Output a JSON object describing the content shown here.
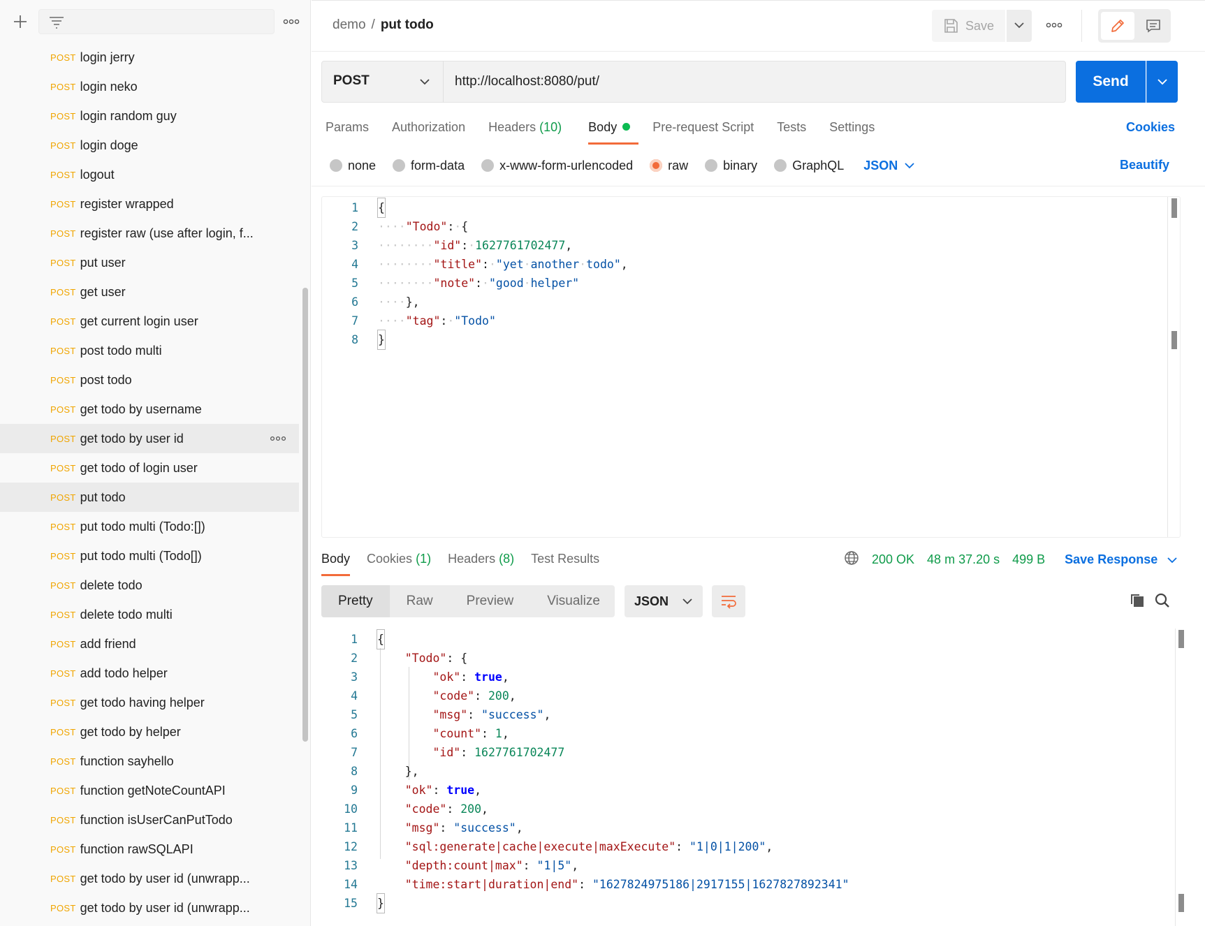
{
  "sidebar": {
    "items": [
      {
        "method": "POST",
        "label": "login jerry"
      },
      {
        "method": "POST",
        "label": "login neko"
      },
      {
        "method": "POST",
        "label": "login random guy"
      },
      {
        "method": "POST",
        "label": "login doge"
      },
      {
        "method": "POST",
        "label": "logout"
      },
      {
        "method": "POST",
        "label": "register wrapped"
      },
      {
        "method": "POST",
        "label": "register raw (use after login, f..."
      },
      {
        "method": "POST",
        "label": "put user"
      },
      {
        "method": "POST",
        "label": "get user"
      },
      {
        "method": "POST",
        "label": "get current login user"
      },
      {
        "method": "POST",
        "label": "post todo multi"
      },
      {
        "method": "POST",
        "label": "post todo"
      },
      {
        "method": "POST",
        "label": "get todo by username"
      },
      {
        "method": "POST",
        "label": "get todo by user id"
      },
      {
        "method": "POST",
        "label": "get todo of login user"
      },
      {
        "method": "POST",
        "label": "put todo"
      },
      {
        "method": "POST",
        "label": "put todo multi (Todo:[])"
      },
      {
        "method": "POST",
        "label": "put todo multi (Todo[])"
      },
      {
        "method": "POST",
        "label": "delete todo"
      },
      {
        "method": "POST",
        "label": "delete todo multi"
      },
      {
        "method": "POST",
        "label": "add friend"
      },
      {
        "method": "POST",
        "label": "add todo helper"
      },
      {
        "method": "POST",
        "label": "get todo having helper"
      },
      {
        "method": "POST",
        "label": "get todo by helper"
      },
      {
        "method": "POST",
        "label": "function sayhello"
      },
      {
        "method": "POST",
        "label": "function getNoteCountAPI"
      },
      {
        "method": "POST",
        "label": "function isUserCanPutTodo"
      },
      {
        "method": "POST",
        "label": "function rawSQLAPI"
      },
      {
        "method": "POST",
        "label": "get todo by user id (unwrapp..."
      },
      {
        "method": "POST",
        "label": "get todo by user id (unwrapp..."
      }
    ]
  },
  "header": {
    "breadcrumb_parent": "demo",
    "breadcrumb_sep": "/",
    "breadcrumb_current": "put todo",
    "save_label": "Save"
  },
  "request": {
    "method": "POST",
    "url": "http://localhost:8080/put/",
    "send_label": "Send",
    "tabs": {
      "params": "Params",
      "authorization": "Authorization",
      "headers": "Headers",
      "headers_count": "(10)",
      "body": "Body",
      "prerequest": "Pre-request Script",
      "tests": "Tests",
      "settings": "Settings"
    },
    "cookies_label": "Cookies",
    "body_types": {
      "none": "none",
      "form_data": "form-data",
      "urlencoded": "x-www-form-urlencoded",
      "raw": "raw",
      "binary": "binary",
      "graphql": "GraphQL"
    },
    "body_format": "JSON",
    "beautify_label": "Beautify",
    "line_numbers": [
      "1",
      "2",
      "3",
      "4",
      "5",
      "6",
      "7",
      "8"
    ]
  },
  "response": {
    "tabs": {
      "body": "Body",
      "cookies": "Cookies",
      "cookies_count": "(1)",
      "headers": "Headers",
      "headers_count": "(8)",
      "test_results": "Test Results"
    },
    "status": "200 OK",
    "time": "48 m 37.20 s",
    "size": "499 B",
    "save_response": "Save Response",
    "view_tabs": {
      "pretty": "Pretty",
      "raw": "Raw",
      "preview": "Preview",
      "visualize": "Visualize"
    },
    "format": "JSON",
    "line_numbers": [
      "1",
      "2",
      "3",
      "4",
      "5",
      "6",
      "7",
      "8",
      "9",
      "10",
      "11",
      "12",
      "13",
      "14",
      "15"
    ]
  },
  "colors": {
    "accent_orange": "#f26b3a",
    "primary_blue": "#0b6fe0",
    "method_post": "#f0a500",
    "success_green": "#0f9b4a"
  }
}
